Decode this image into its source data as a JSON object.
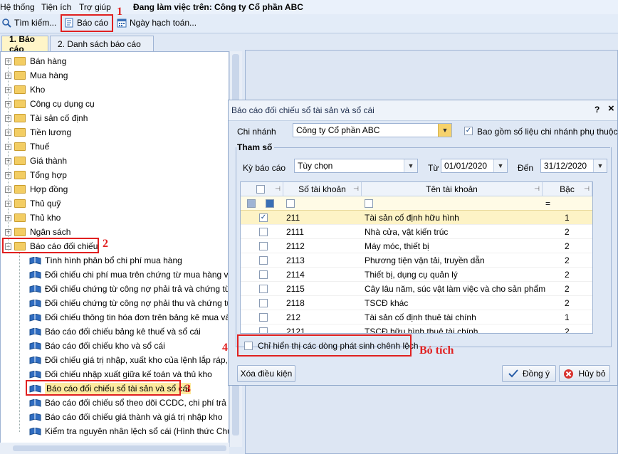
{
  "menu": {
    "items": [
      "Hệ thống",
      "Tiện ích",
      "Trợ giúp"
    ],
    "working_on": "Đang làm việc trên:  Công ty Cổ phần ABC"
  },
  "toolbar": {
    "search": "Tìm kiếm...",
    "report": "Báo cáo",
    "accounting_date": "Ngày hạch toán..."
  },
  "tabs": [
    "1. Báo cáo",
    "2. Danh sách báo cáo"
  ],
  "tree": {
    "folders": [
      "Bán hàng",
      "Mua hàng",
      "Kho",
      "Công cụ dụng cụ",
      "Tài sản cố định",
      "Tiền lương",
      "Thuế",
      "Giá thành",
      "Tổng hợp",
      "Hợp đồng",
      "Thủ quỹ",
      "Thủ kho",
      "Ngân sách",
      "Báo cáo đối chiếu"
    ],
    "reports": [
      "Tình hình phân bổ chi phí mua hàng",
      "Đối chiếu chi phí mua trên chứng từ mua hàng và c",
      "Đối chiếu chứng từ công nợ phải trả và chứng từ tha",
      "Đối chiếu chứng từ công nợ phải thu và chứng từ th",
      "Đối chiếu thông tin hóa đơn trên bảng kê mua vào v",
      "Báo cáo đối chiếu bảng kê thuế và sổ cái",
      "Báo cáo đối chiếu kho và sổ cái",
      "Đối chiếu giá trị nhập, xuất kho của lệnh lắp ráp, th",
      "Đối chiếu nhập xuất giữa kế toán và thủ kho",
      "Báo cáo đối chiếu sổ tài sản và sổ cái",
      "Báo cáo đối chiếu sổ theo dõi CCDC, chi phí trả trư",
      "Báo cáo đối chiếu giá thành và giá trị nhập kho",
      "Kiểm tra nguyên nhân lệch sổ cái (Hình thức Chứng"
    ]
  },
  "annotations": [
    "1",
    "2",
    "3",
    "4",
    "Bỏ tích"
  ],
  "dialog": {
    "title": "Báo cáo đối chiếu sổ tài sản và sổ cái",
    "help": "?",
    "close": "×",
    "branch_label": "Chi nhánh",
    "branch_value": "Công ty Cổ phần ABC",
    "include_branches": "Bao gồm số liệu chi nhánh phụ thuộc",
    "params_label": "Tham số",
    "period_label": "Kỳ báo cáo",
    "period_value": "Tùy chọn",
    "from_label": "Từ",
    "from_value": "01/01/2020",
    "to_label": "Đến",
    "to_value": "31/12/2020",
    "grid": {
      "headers": [
        "Số tài khoản",
        "Tên tài khoản",
        "Bậc"
      ],
      "filter_eq": "=",
      "rows": [
        {
          "code": "211",
          "name": "Tài sản cố định hữu hình",
          "level": "1",
          "checked": true
        },
        {
          "code": "2111",
          "name": "Nhà cửa, vật kiến trúc",
          "level": "2",
          "checked": false
        },
        {
          "code": "2112",
          "name": "Máy móc, thiết bị",
          "level": "2",
          "checked": false
        },
        {
          "code": "2113",
          "name": "Phương tiện vận tải, truyền dẫn",
          "level": "2",
          "checked": false
        },
        {
          "code": "2114",
          "name": "Thiết bị, dụng cụ quản lý",
          "level": "2",
          "checked": false
        },
        {
          "code": "2115",
          "name": "Cây lâu năm, súc vật làm việc và cho sản phẩm",
          "level": "2",
          "checked": false
        },
        {
          "code": "2118",
          "name": "TSCĐ khác",
          "level": "2",
          "checked": false
        },
        {
          "code": "212",
          "name": "Tài sản cố định thuê tài chính",
          "level": "1",
          "checked": false
        },
        {
          "code": "2121",
          "name": "TSCĐ hữu hình thuê tài chính",
          "level": "2",
          "checked": false
        }
      ]
    },
    "only_diff": "Chỉ hiển thị các dòng phát sinh chênh lệch",
    "clear": "Xóa điều kiện",
    "ok": "Đồng ý",
    "cancel": "Hủy bỏ"
  },
  "colors": {
    "accent_red": "#e02020",
    "folder": "#f3cd63",
    "selected_row": "#fdf3c6"
  }
}
